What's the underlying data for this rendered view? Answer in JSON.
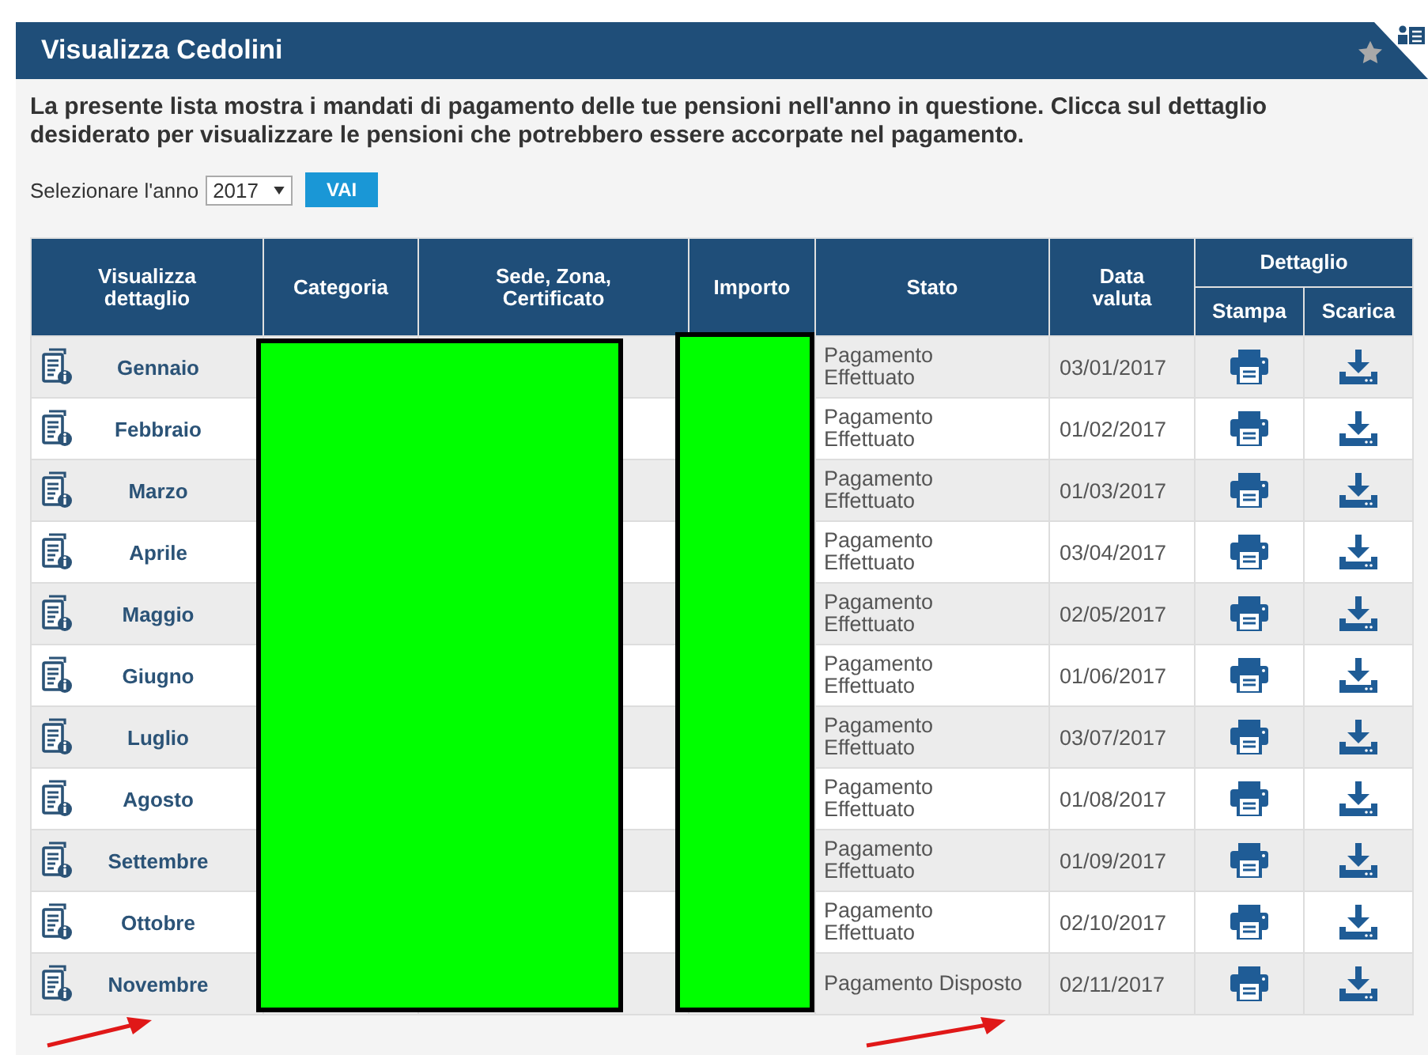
{
  "panel": {
    "title": "Visualizza Cedolini",
    "intro": "La presente lista mostra i mandati di pagamento delle tue pensioni nell'anno in questione. Clicca sul dettaglio desiderato per visualizzare le pensioni che potrebbero essere accorpate nel pagamento."
  },
  "year_select": {
    "label": "Selezionare l'anno",
    "value": "2017",
    "button": "VAI"
  },
  "table": {
    "columns": [
      "Visualizza dettaglio",
      "Categoria",
      "Sede, Zona, Certificato",
      "Importo",
      "Stato",
      "Data valuta"
    ],
    "group_column": "Dettaglio",
    "sub_columns": [
      "Stampa",
      "Scarica"
    ],
    "rows": [
      {
        "month": "Gennaio",
        "stato": "Pagamento\nEffettuato",
        "data": "03/01/2017"
      },
      {
        "month": "Febbraio",
        "stato": "Pagamento\nEffettuato",
        "data": "01/02/2017"
      },
      {
        "month": "Marzo",
        "stato": "Pagamento\nEffettuato",
        "data": "01/03/2017"
      },
      {
        "month": "Aprile",
        "stato": "Pagamento\nEffettuato",
        "data": "03/04/2017"
      },
      {
        "month": "Maggio",
        "stato": "Pagamento\nEffettuato",
        "data": "02/05/2017"
      },
      {
        "month": "Giugno",
        "stato": "Pagamento\nEffettuato",
        "data": "01/06/2017"
      },
      {
        "month": "Luglio",
        "stato": "Pagamento\nEffettuato",
        "data": "03/07/2017"
      },
      {
        "month": "Agosto",
        "stato": "Pagamento\nEffettuato",
        "data": "01/08/2017"
      },
      {
        "month": "Settembre",
        "stato": "Pagamento\nEffettuato",
        "data": "01/09/2017"
      },
      {
        "month": "Ottobre",
        "stato": "Pagamento\nEffettuato",
        "data": "02/10/2017"
      },
      {
        "month": "Novembre",
        "stato": "Pagamento Disposto",
        "data": "02/11/2017"
      }
    ]
  }
}
